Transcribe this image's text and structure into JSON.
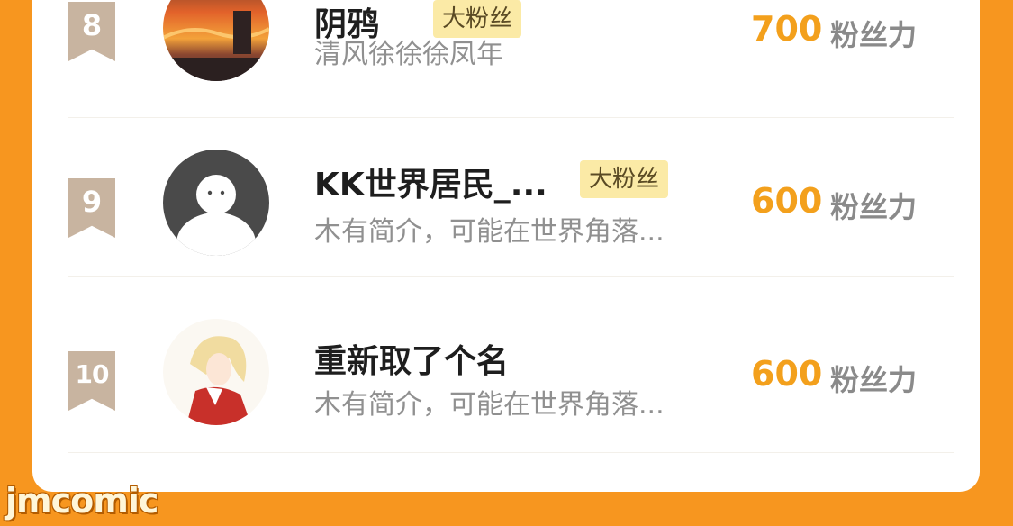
{
  "colors": {
    "page_background": "#f7961f",
    "card_background": "#ffffff",
    "rank_ribbon": "#c8b4a0",
    "score": "#f3a01c",
    "badge_background": "#fbeaa6"
  },
  "ranking": {
    "rows": [
      {
        "rank": "8",
        "name": "阴鸦",
        "badge": "大粉丝",
        "bio": "清风徐徐徐凤年",
        "score": "700",
        "unit": "粉丝力",
        "avatar_icon": "sunset-avatar"
      },
      {
        "rank": "9",
        "name": "KK世界居民_...",
        "badge": "大粉丝",
        "bio": "木有简介，可能在世界角落...",
        "score": "600",
        "unit": "粉丝力",
        "avatar_icon": "default-user-avatar"
      },
      {
        "rank": "10",
        "name": "重新取了个名",
        "badge": "",
        "bio": "木有简介，可能在世界角落...",
        "score": "600",
        "unit": "粉丝力",
        "avatar_icon": "anime-girl-avatar"
      }
    ]
  },
  "watermark": "jmcomic"
}
